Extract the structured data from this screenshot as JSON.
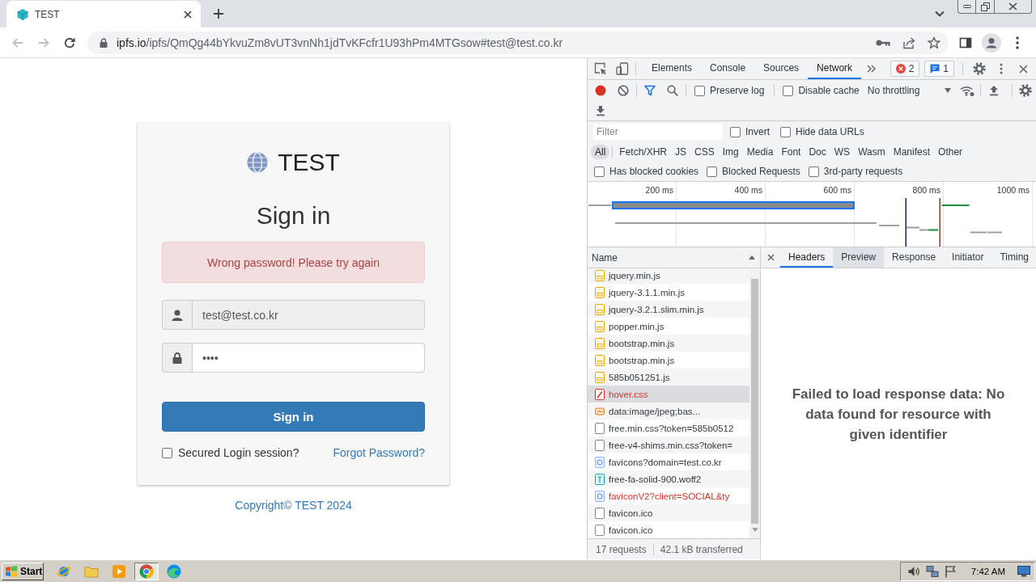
{
  "browser": {
    "tab": {
      "title": "TEST",
      "selected": true
    },
    "nav": [
      {
        "kind": "back",
        "disabled": true
      },
      {
        "kind": "forward",
        "disabled": true
      },
      {
        "kind": "reload",
        "disabled": false
      }
    ],
    "address": {
      "host": "ipfs.io",
      "path": "/ipfs/QmQg44bYkvuZm8vUT3vnNh1jdTvKFcfr1U93hPm4MTGsow#test@test.co.kr"
    }
  },
  "login": {
    "brand": "TEST",
    "heading": "Sign in",
    "alert": "Wrong password! Please try again",
    "fields": [
      {
        "kind": "user",
        "value": "test@test.co.kr",
        "readonly": true
      },
      {
        "kind": "password",
        "value": "••••",
        "readonly": false
      }
    ],
    "submit": "Sign in",
    "remember": {
      "label": "Secured Login session?",
      "checked": false
    },
    "forgot": "Forgot Password?",
    "footer": "Copyright© TEST 2024"
  },
  "devtools": {
    "panels": [
      {
        "label": "Elements",
        "selected": false
      },
      {
        "label": "Console",
        "selected": false
      },
      {
        "label": "Sources",
        "selected": false
      },
      {
        "label": "Network",
        "selected": true
      }
    ],
    "errors": "2",
    "messages": "1",
    "recording": true,
    "options": [
      {
        "label": "Preserve log",
        "checked": false
      },
      {
        "label": "Disable cache",
        "checked": false
      }
    ],
    "throttling": "No throttling",
    "filter": {
      "placeholder": "Filter"
    },
    "filter_options": [
      {
        "label": "Invert",
        "checked": false
      },
      {
        "label": "Hide data URLs",
        "checked": false
      }
    ],
    "types": [
      {
        "label": "All",
        "selected": true
      },
      {
        "label": "Fetch/XHR",
        "selected": false
      },
      {
        "label": "JS",
        "selected": false
      },
      {
        "label": "CSS",
        "selected": false
      },
      {
        "label": "Img",
        "selected": false
      },
      {
        "label": "Media",
        "selected": false
      },
      {
        "label": "Font",
        "selected": false
      },
      {
        "label": "Doc",
        "selected": false
      },
      {
        "label": "WS",
        "selected": false
      },
      {
        "label": "Wasm",
        "selected": false
      },
      {
        "label": "Manifest",
        "selected": false
      },
      {
        "label": "Other",
        "selected": false
      }
    ],
    "request_options": [
      {
        "label": "Has blocked cookies",
        "checked": false
      },
      {
        "label": "Blocked Requests",
        "checked": false
      },
      {
        "label": "3rd-party requests",
        "checked": false
      }
    ],
    "overview": {
      "ticks": [
        "200 ms",
        "400 ms",
        "600 ms",
        "800 ms",
        "1000 ms"
      ]
    },
    "name_header": "Name",
    "requests": [
      {
        "name": "jquery.min.js",
        "kind": "script",
        "failed": false,
        "selected": false
      },
      {
        "name": "jquery-3.1.1.min.js",
        "kind": "script",
        "failed": false,
        "selected": false
      },
      {
        "name": "jquery-3.2.1.slim.min.js",
        "kind": "script",
        "failed": false,
        "selected": false
      },
      {
        "name": "popper.min.js",
        "kind": "script",
        "failed": false,
        "selected": false
      },
      {
        "name": "bootstrap.min.js",
        "kind": "script",
        "failed": false,
        "selected": false
      },
      {
        "name": "bootstrap.min.js",
        "kind": "script",
        "failed": false,
        "selected": false
      },
      {
        "name": "585b051251.js",
        "kind": "script",
        "failed": false,
        "selected": false
      },
      {
        "name": "hover.css",
        "kind": "stylesheet",
        "failed": true,
        "selected": true
      },
      {
        "name": "data:image/jpeg;bas...",
        "kind": "image",
        "failed": false,
        "selected": false
      },
      {
        "name": "free.min.css?token=585b0512",
        "kind": "other",
        "failed": false,
        "selected": false
      },
      {
        "name": "free-v4-shims.min.css?token=",
        "kind": "other",
        "failed": false,
        "selected": false
      },
      {
        "name": "favicons?domain=test.co.kr",
        "kind": "favicon",
        "failed": false,
        "selected": false
      },
      {
        "name": "free-fa-solid-900.woff2",
        "kind": "font",
        "failed": false,
        "selected": false
      },
      {
        "name": "faviconV2?client=SOCIAL&ty",
        "kind": "favicon",
        "failed": true,
        "selected": false
      },
      {
        "name": "favicon.ico",
        "kind": "other",
        "failed": false,
        "selected": false
      },
      {
        "name": "favicon.ico",
        "kind": "other",
        "failed": false,
        "selected": false
      }
    ],
    "summary": {
      "requests": "17 requests",
      "transferred": "42.1 kB transferred"
    },
    "detail_tabs": [
      {
        "label": "Headers",
        "selected": true,
        "hovered": false
      },
      {
        "label": "Preview",
        "selected": false,
        "hovered": true
      },
      {
        "label": "Response",
        "selected": false,
        "hovered": false
      },
      {
        "label": "Initiator",
        "selected": false,
        "hovered": false
      },
      {
        "label": "Timing",
        "selected": false,
        "hovered": false
      }
    ],
    "message": "Failed to load response data: No data found for resource with given identifier"
  },
  "taskbar": {
    "start": "Start",
    "apps": [
      {
        "kind": "orbit",
        "active": false
      },
      {
        "kind": "folder",
        "active": false
      },
      {
        "kind": "player",
        "active": false
      },
      {
        "kind": "ball",
        "active": true
      },
      {
        "kind": "wave",
        "active": false
      }
    ],
    "clock": "7:42 AM"
  }
}
